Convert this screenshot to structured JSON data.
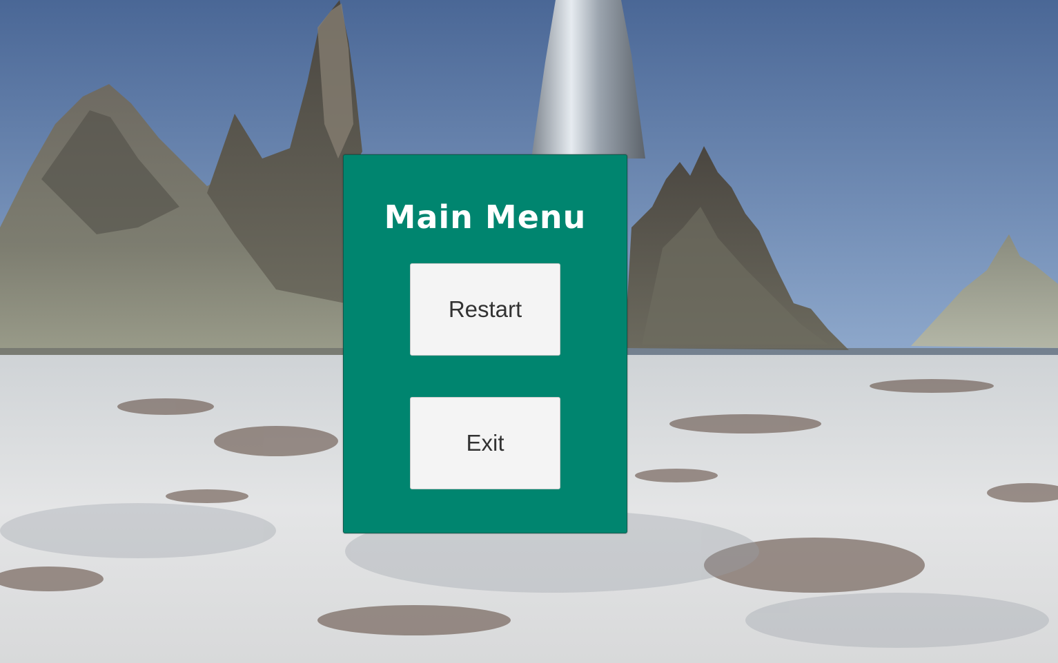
{
  "scene": {
    "colors": {
      "sky_top": "#4a6796",
      "sky_bottom": "#8fa9cc",
      "ground": "#dfe0e2",
      "panel": "#00856f",
      "button": "#f4f4f4",
      "button_text": "#323232",
      "title_text": "#ffffff"
    }
  },
  "menu": {
    "title": "Main Menu",
    "buttons": {
      "restart_label": "Restart",
      "exit_label": "Exit"
    }
  }
}
